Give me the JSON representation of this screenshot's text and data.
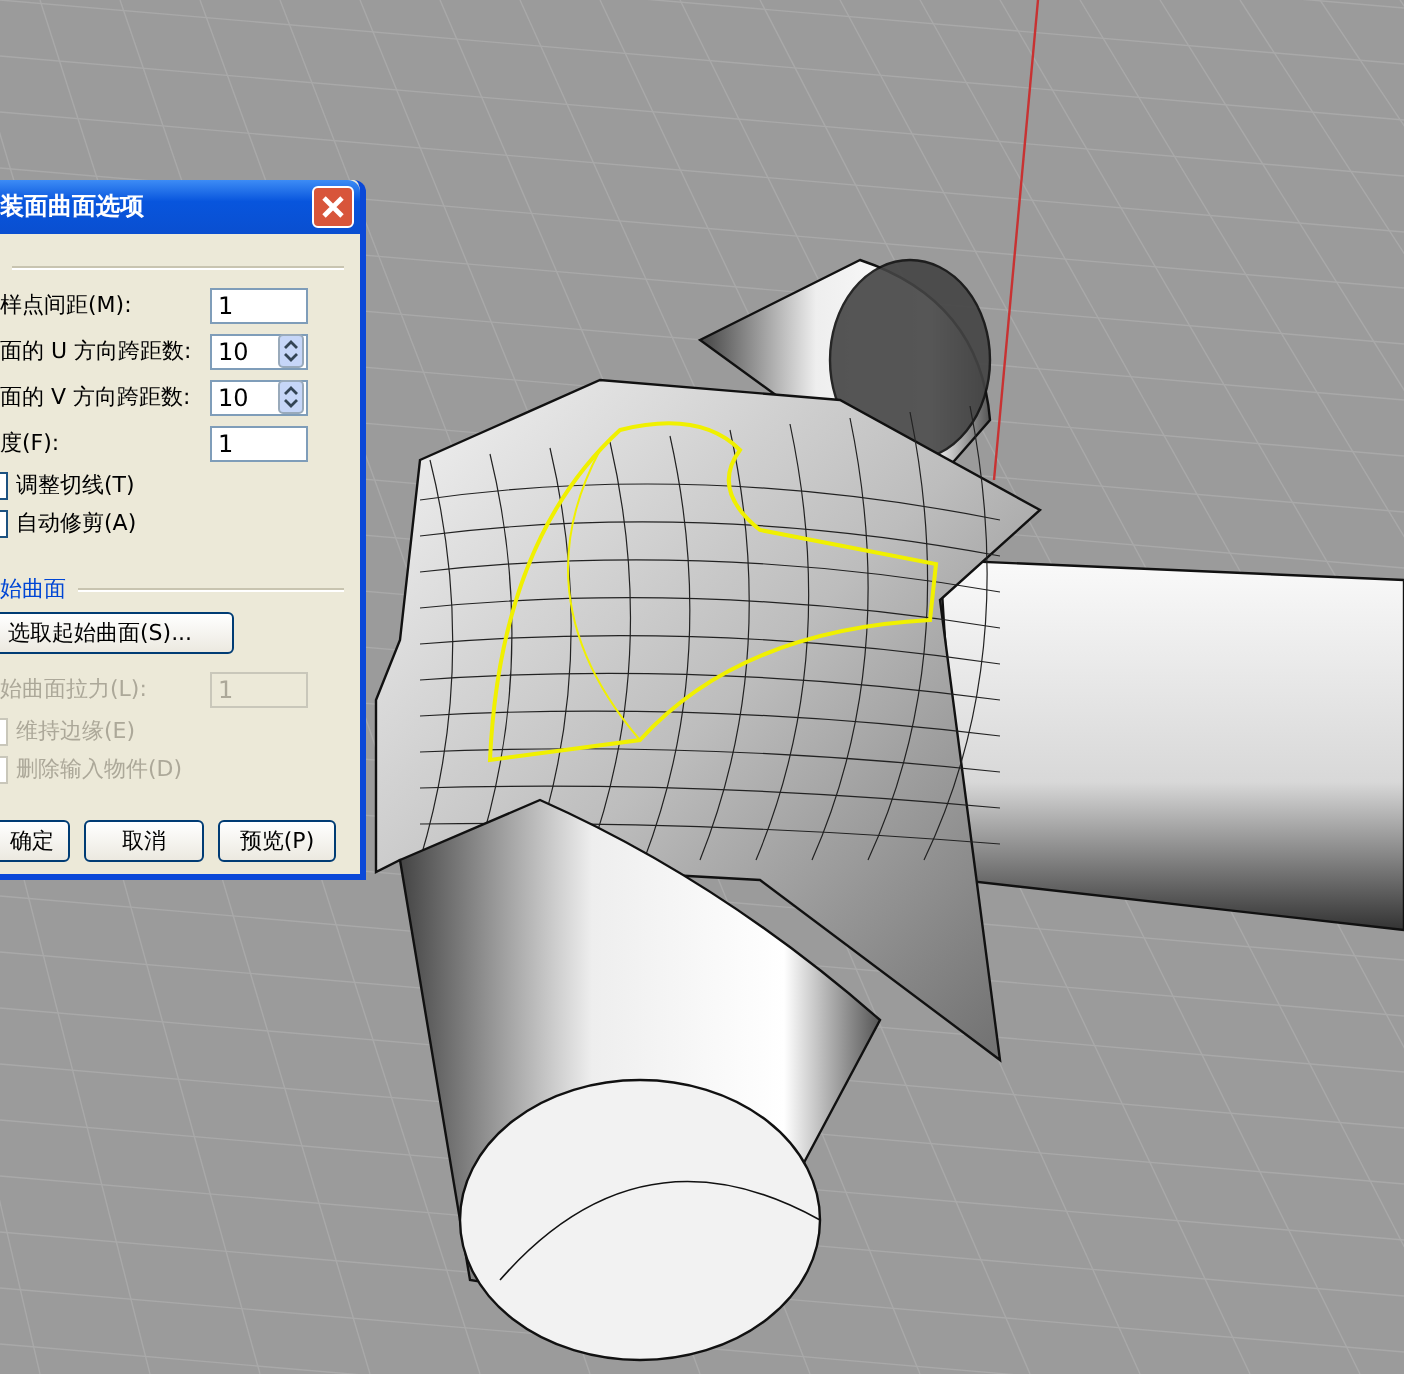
{
  "dialog": {
    "title": "装面曲面选项",
    "fields": [
      {
        "kind": "text",
        "label": "样点间距(M):",
        "value": "1"
      },
      {
        "kind": "spin",
        "label": "面的 U 方向跨距数:",
        "value": "10"
      },
      {
        "kind": "spin",
        "label": "面的 V 方向跨距数:",
        "value": "10"
      },
      {
        "kind": "text",
        "label": "度(F):",
        "value": "1"
      }
    ],
    "checkboxes": [
      {
        "label": "调整切线(T)",
        "checked": false,
        "disabled": false
      },
      {
        "label": "自动修剪(A)",
        "checked": false,
        "disabled": false
      }
    ],
    "group_label": "始曲面",
    "select_button": "选取起始曲面(S)...",
    "stiffness": {
      "label": "始曲面拉力(L):",
      "value": "1",
      "disabled": true
    },
    "checkboxes_2": [
      {
        "label": "维持边缘(E)",
        "checked": false,
        "disabled": true
      },
      {
        "label": "删除输入物件(D)",
        "checked": false,
        "disabled": true
      }
    ],
    "buttons": [
      "确定",
      "取消",
      "预览(P)"
    ]
  }
}
